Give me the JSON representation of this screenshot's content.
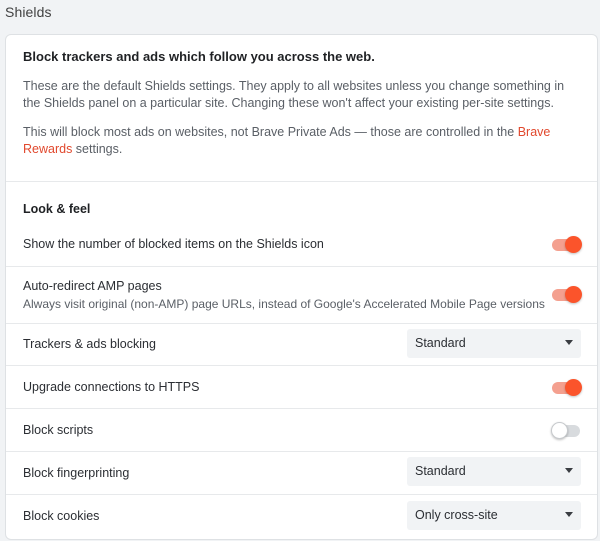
{
  "page": {
    "title": "Shields"
  },
  "intro": {
    "heading": "Block trackers and ads which follow you across the web.",
    "paragraph1": "These are the default Shields settings. They apply to all websites unless you change something in the Shields panel on a particular site. Changing these won't affect your existing per-site settings.",
    "paragraph2_before": "This will block most ads on websites, not Brave Private Ads — those are controlled in the ",
    "paragraph2_link": "Brave Rewards",
    "paragraph2_after": " settings."
  },
  "look_and_feel": {
    "title": "Look & feel",
    "show_blocked_count": {
      "label": "Show the number of blocked items on the Shields icon",
      "enabled": true
    },
    "auto_redirect_amp": {
      "label": "Auto-redirect AMP pages",
      "sublabel": "Always visit original (non-AMP) page URLs, instead of Google's Accelerated Mobile Page versions",
      "enabled": true
    },
    "trackers_ads_blocking": {
      "label": "Trackers & ads blocking",
      "value": "Standard"
    },
    "upgrade_https": {
      "label": "Upgrade connections to HTTPS",
      "enabled": true
    },
    "block_scripts": {
      "label": "Block scripts",
      "enabled": false
    },
    "block_fingerprinting": {
      "label": "Block fingerprinting",
      "value": "Standard"
    },
    "block_cookies": {
      "label": "Block cookies",
      "value": "Only cross-site"
    }
  },
  "colors": {
    "accent": "#fb542b",
    "accent_track": "#f4a08f",
    "link": "#e1482d"
  }
}
